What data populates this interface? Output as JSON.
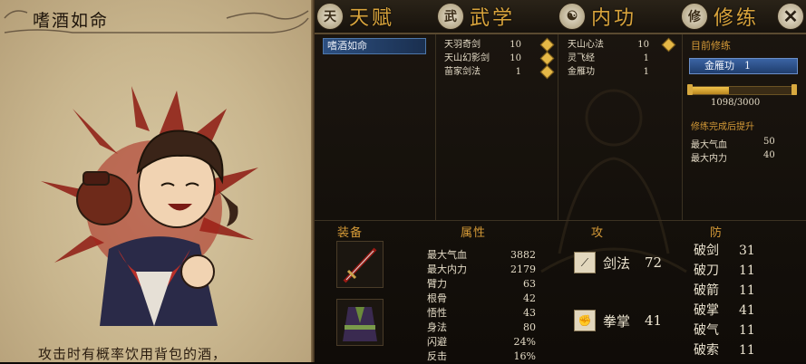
{
  "card": {
    "title": "嗜酒如命",
    "description": "攻击时有概率饮用背包的酒，"
  },
  "tabs": [
    {
      "label": "天赋",
      "icon": "talent-icon",
      "glyph": "天"
    },
    {
      "label": "武学",
      "icon": "martial-icon",
      "glyph": "武"
    },
    {
      "label": "内功",
      "icon": "yin-yang-icon",
      "glyph": "☯"
    },
    {
      "label": "修练",
      "icon": "training-icon",
      "glyph": "修"
    }
  ],
  "close_label": "✕",
  "talents": {
    "selected": "嗜酒如命"
  },
  "martial_arts": [
    {
      "name": "天羽奇剑",
      "level": "10"
    },
    {
      "name": "天山幻影剑",
      "level": "10"
    },
    {
      "name": "苗家剑法",
      "level": "1"
    }
  ],
  "inner_arts": [
    {
      "name": "天山心法",
      "level": "10"
    },
    {
      "name": "灵飞经",
      "level": "1"
    },
    {
      "name": "金雁功",
      "level": "1"
    }
  ],
  "training": {
    "title": "目前修练",
    "current": "金雁功　1",
    "progress_text": "1098/3000",
    "progress_fraction": 0.366,
    "bonus_title": "修练完成后提升",
    "bonuses": [
      {
        "label": "最大气血",
        "value": "50"
      },
      {
        "label": "最大内力",
        "value": "40"
      }
    ]
  },
  "sections": {
    "equipment": "装备",
    "attributes": "属性",
    "attack": "攻",
    "defense": "防"
  },
  "equipment": [
    {
      "icon": "sword-icon"
    },
    {
      "icon": "robe-icon"
    }
  ],
  "attributes": [
    {
      "label": "最大气血",
      "value": "3882"
    },
    {
      "label": "最大内力",
      "value": "2179"
    },
    {
      "label": "臂力",
      "value": "63"
    },
    {
      "label": "根骨",
      "value": "42"
    },
    {
      "label": "悟性",
      "value": "43"
    },
    {
      "label": "身法",
      "value": "80"
    },
    {
      "label": "闪避",
      "value": "24%"
    },
    {
      "label": "反击",
      "value": "16%"
    }
  ],
  "attack": [
    {
      "label": "剑法",
      "value": "72",
      "icon": "sword-skill-icon",
      "glyph": "⟋"
    },
    {
      "label": "拳掌",
      "value": "41",
      "icon": "fist-skill-icon",
      "glyph": "✊"
    }
  ],
  "defense": [
    {
      "label": "破剑",
      "value": "31"
    },
    {
      "label": "破刀",
      "value": "11"
    },
    {
      "label": "破箭",
      "value": "11"
    },
    {
      "label": "破掌",
      "value": "41"
    },
    {
      "label": "破气",
      "value": "11"
    },
    {
      "label": "破索",
      "value": "11"
    }
  ]
}
